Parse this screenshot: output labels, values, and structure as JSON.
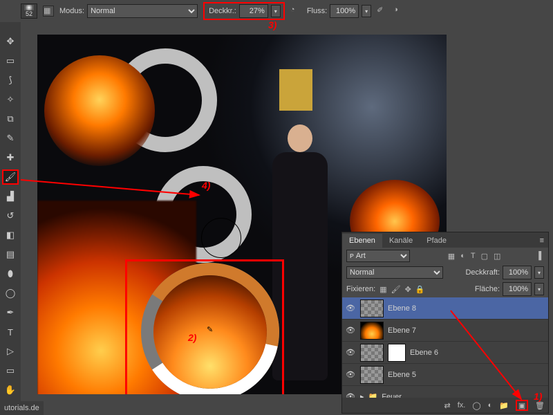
{
  "toolbar": {
    "brush_size": "52",
    "modus_label": "Modus:",
    "modus_value": "Normal",
    "opacity_label": "Deckkr.:",
    "opacity_value": "27%",
    "flow_label": "Fluss:",
    "flow_value": "100%"
  },
  "annotations": {
    "a1": "1)",
    "a2": "2)",
    "a3": "3)",
    "a4": "4)"
  },
  "layers_panel": {
    "tabs": [
      "Ebenen",
      "Kanäle",
      "Pfade"
    ],
    "kind_label": "Art",
    "blend_value": "Normal",
    "opacity_label": "Deckkraft:",
    "opacity_value": "100%",
    "lock_label": "Fixieren:",
    "fill_label": "Fläche:",
    "fill_value": "100%",
    "layers": [
      {
        "name": "Ebene 8",
        "selected": true,
        "thumb": "checker"
      },
      {
        "name": "Ebene 7",
        "selected": false,
        "thumb": "fire"
      },
      {
        "name": "Ebene 6",
        "selected": false,
        "thumb": "checker",
        "mask": true
      },
      {
        "name": "Ebene 5",
        "selected": false,
        "thumb": "checker"
      },
      {
        "name": "Feuer",
        "selected": false,
        "group": true
      }
    ]
  },
  "footer_text": "utorials.de",
  "icons": {
    "eyedropper": "✎"
  }
}
